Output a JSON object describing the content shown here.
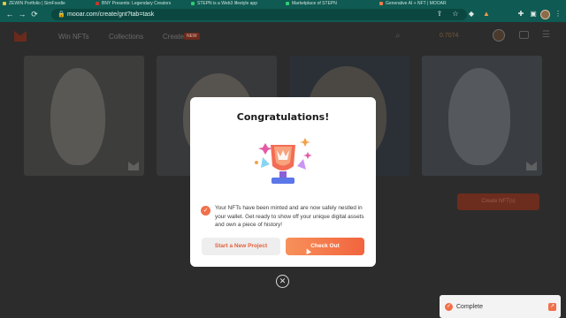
{
  "browser": {
    "tabs": [
      {
        "label": "ZEWIN Portfolio | SimFoodie",
        "color": "#e8c547"
      },
      {
        "label": "BNY Presents: Legendary Creators",
        "color": "#c0392b"
      },
      {
        "label": "STEPN is a Web3 lifestyle app",
        "color": "#2ecc71"
      },
      {
        "label": "Marketplace of STEPN",
        "color": "#2ecc71"
      },
      {
        "label": "Generative AI + NFT | MOOAR",
        "color": "#f07a4a"
      }
    ],
    "url": "mooar.com/create/gnt?tab=task"
  },
  "site": {
    "nav": {
      "win_nfts": "Win NFTs",
      "collections": "Collections",
      "create": "Create",
      "create_badge": "NEW"
    },
    "balance": "0.7074",
    "checkout_label": "Create NFT(s)"
  },
  "modal": {
    "title": "Congratulations!",
    "message": "Your NFTs have been minted and are now safely nestled in your wallet. Get ready to show off your unique digital assets and own a piece of history!",
    "secondary_button": "Start a New Project",
    "primary_button": "Check Out"
  },
  "toast": {
    "label": "Complete"
  },
  "colors": {
    "accent": "#f2643e",
    "browser_chrome": "#0f5a52"
  }
}
